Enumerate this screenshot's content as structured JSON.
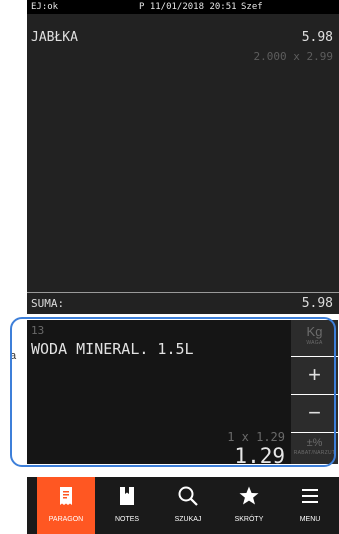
{
  "status": {
    "left": "EJ:ok",
    "date": "P 11/01/2018 20:51",
    "user": "Szef"
  },
  "receipt": {
    "items": [
      {
        "name": "JABŁKA",
        "total": "5.98",
        "detail": "2.000 x 2.99"
      }
    ],
    "sum_label": "SUMA:",
    "sum_value": "5.98"
  },
  "side_label": "a",
  "entry": {
    "plu": "13",
    "product": "WODA MINERAL. 1.5L",
    "qty_line": "1 x 1.29",
    "price": "1.29"
  },
  "keys": {
    "weight": {
      "label": "Kg",
      "sub": "WAGA"
    },
    "plus": {
      "label": "+"
    },
    "minus": {
      "label": "−"
    },
    "discount": {
      "label": "±%",
      "sub": "RABAT/NARZUT"
    }
  },
  "nav": [
    {
      "label": "PARAGON",
      "icon": "receipt-icon"
    },
    {
      "label": "NOTES",
      "icon": "notes-icon"
    },
    {
      "label": "SZUKAJ",
      "icon": "search-icon"
    },
    {
      "label": "SKRÓTY",
      "icon": "star-icon"
    },
    {
      "label": "MENU",
      "icon": "menu-icon"
    }
  ],
  "colors": {
    "accent": "#ff5722",
    "highlight_frame": "#3d7fd9"
  }
}
